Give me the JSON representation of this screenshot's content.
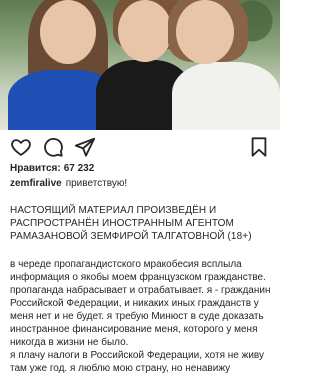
{
  "post": {
    "likes_label": "Нравится:",
    "likes_count": "67 232",
    "username": "zemfiralive",
    "greeting": "приветствую!",
    "notice": "НАСТОЯЩИЙ МАТЕРИАЛ ПРОИЗВЕДЁН И РАСПРОСТРАНЁН ИНОСТРАННЫМ АГЕНТОМ РАМАЗАНОВОЙ ЗЕМФИРОЙ ТАЛГАТОВНОЙ (18+)",
    "paragraphs": [
      "в череде пропагандистского мракобесия всплыла информация о якобы моем французском гражданстве. пропаганда набрасывает и отрабатывает. я - гражданин Российской Федерации, и никаких иных гражданств у меня нет и не будет. я требую Минюст в суде доказать иностранное финансирование меня, которого у меня никогда в жизни не было.",
      "я плачу налоги в Российской Федерации, хотя не живу там уже год. я люблю мою страну, но ненавижу"
    ]
  },
  "icons": {
    "like": "heart-icon",
    "comment": "comment-icon",
    "share": "send-icon",
    "save": "bookmark-icon"
  }
}
